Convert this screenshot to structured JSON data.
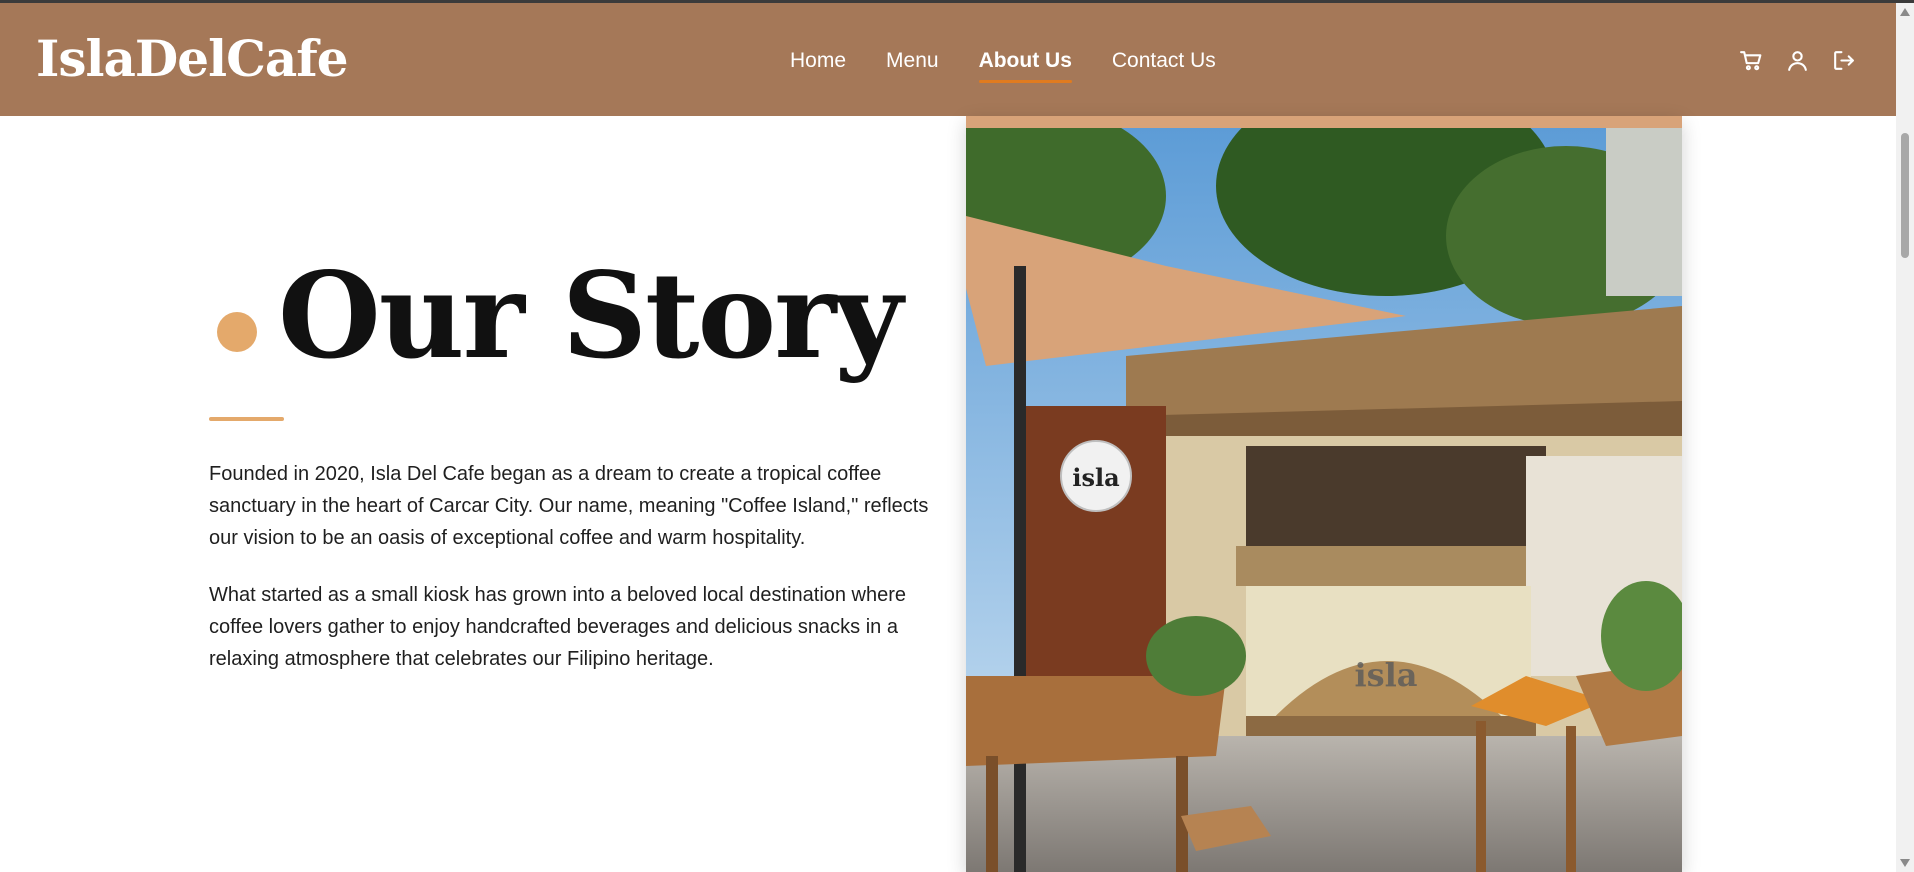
{
  "brand": {
    "name": "IslaDelCafe"
  },
  "nav": {
    "items": [
      {
        "label": "Home",
        "active": false
      },
      {
        "label": "Menu",
        "active": false
      },
      {
        "label": "About Us",
        "active": true
      },
      {
        "label": "Contact Us",
        "active": false
      }
    ]
  },
  "actions": {
    "icons": [
      "cart-icon",
      "user-icon",
      "logout-icon"
    ]
  },
  "about": {
    "title": "Our Story",
    "paragraphs": [
      "Founded in 2020, Isla Del Cafe began as a dream to create a tropical coffee sanctuary in the heart of Carcar City. Our name, meaning \"Coffee Island,\" reflects our vision to be an oasis of exceptional coffee and warm hospitality.",
      "What started as a small kiosk has grown into a beloved local destination where coffee lovers gather to enjoy handcrafted beverages and delicious snacks in a relaxing atmosphere that celebrates our Filipino heritage."
    ],
    "image_sign": "isla"
  },
  "colors": {
    "header_bg": "#a57858",
    "accent": "#e4a96b",
    "active_underline": "#e07b1f",
    "text": "#1f1f1f"
  }
}
